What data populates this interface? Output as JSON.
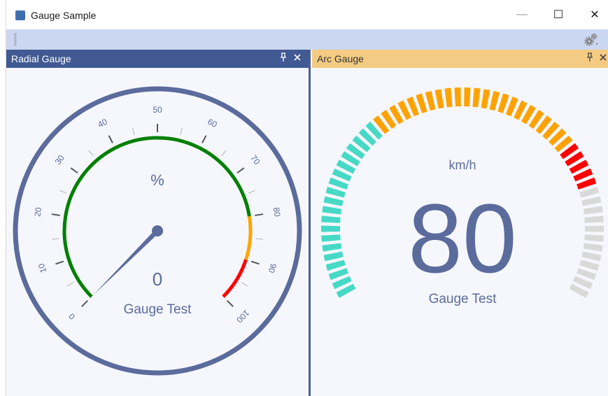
{
  "window": {
    "title": "Gauge Sample",
    "controls": {
      "minimize": "—",
      "maximize": "☐",
      "close": "✕"
    }
  },
  "toolbar": {
    "icon": "gear-icon"
  },
  "panels": {
    "radial": {
      "title": "Radial Gauge",
      "pin_icon": "pin-icon",
      "close_icon": "close-icon",
      "unit": "%",
      "value_text": "0",
      "value": 0,
      "caption": "Gauge Test",
      "scale": {
        "min": 0,
        "max": 100,
        "labels": [
          "0",
          "10",
          "20",
          "30",
          "40",
          "50",
          "60",
          "70",
          "80",
          "90",
          "100"
        ]
      },
      "ranges": [
        {
          "from": 0,
          "to": 80,
          "color": "#008000"
        },
        {
          "from": 80,
          "to": 90,
          "color": "#ffa500"
        },
        {
          "from": 90,
          "to": 100,
          "color": "#ff0000"
        }
      ],
      "colors": {
        "frame": "#5b6b9c",
        "needle": "#5b6b9c",
        "text": "#5b6b9c"
      }
    },
    "arc": {
      "title": "Arc Gauge",
      "pin_icon": "pin-icon",
      "close_icon": "close-icon",
      "unit": "km/h",
      "value_text": "80",
      "value": 80,
      "caption": "Gauge Test",
      "segments_total": 60,
      "colors": {
        "low": "#45d9c6",
        "mid": "#ffa200",
        "high": "#ff0000",
        "inactive": "#d9d9d9",
        "text": "#5b6b9c"
      }
    }
  }
}
